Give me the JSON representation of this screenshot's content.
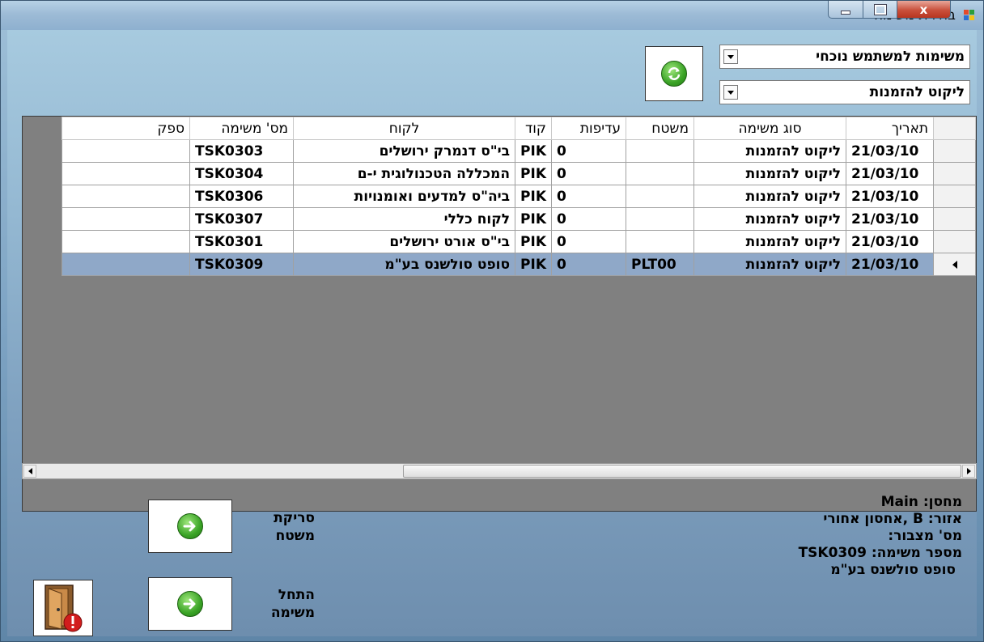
{
  "window": {
    "title": "בחירת משימה",
    "controls": {
      "minimize": "–",
      "maximize": "□",
      "close": "x"
    }
  },
  "filters": {
    "list_selector": "משימות למשתמש נוכחי",
    "task_type_selector": "ליקוט להזמנות"
  },
  "grid": {
    "columns": [
      "תאריך",
      "סוג משימה",
      "משטח",
      "עדיפות",
      "קוד",
      "לקוח",
      "מס' משימה",
      "ספק"
    ],
    "rows": [
      {
        "date": "21/03/10",
        "type": "ליקוט להזמנות",
        "pallet": "",
        "priority": "0",
        "code": "PIK",
        "customer": "בי\"ס דנמרק ירושלים",
        "task_no": "TSK0303",
        "supplier": ""
      },
      {
        "date": "21/03/10",
        "type": "ליקוט להזמנות",
        "pallet": "",
        "priority": "0",
        "code": "PIK",
        "customer": "המכללה הטכנולוגית י-ם",
        "task_no": "TSK0304",
        "supplier": ""
      },
      {
        "date": "21/03/10",
        "type": "ליקוט להזמנות",
        "pallet": "",
        "priority": "0",
        "code": "PIK",
        "customer": "ביה\"ס למדעים ואומנויות",
        "task_no": "TSK0306",
        "supplier": ""
      },
      {
        "date": "21/03/10",
        "type": "ליקוט להזמנות",
        "pallet": "",
        "priority": "0",
        "code": "PIK",
        "customer": "לקוח כללי",
        "task_no": "TSK0307",
        "supplier": ""
      },
      {
        "date": "21/03/10",
        "type": "ליקוט להזמנות",
        "pallet": "",
        "priority": "0",
        "code": "PIK",
        "customer": "בי\"ס אורט ירושלים",
        "task_no": "TSK0301",
        "supplier": ""
      },
      {
        "date": "21/03/10",
        "type": "ליקוט להזמנות",
        "pallet": "PLT00",
        "priority": "0",
        "code": "PIK",
        "customer": "סופט סולשנס בע\"מ",
        "task_no": "TSK0309",
        "supplier": "",
        "selected": true
      }
    ]
  },
  "info": {
    "warehouse": "מחסן: Main",
    "zone": "אזור: B ,אחסון אחורי",
    "stack_no": "מס' מצבור:",
    "task_no": "מספר משימה: TSK0309",
    "customer": "סופט סולשנס בע\"מ"
  },
  "buttons": {
    "scan_pallet_line1": "סריקת",
    "scan_pallet_line2": "משטח",
    "start_task_line1": "התחל",
    "start_task_line2": "משימה"
  },
  "icons": {
    "refresh": "refresh-icon",
    "go": "arrow-right-circle-icon",
    "exit": "door-exit-icon"
  },
  "colors": {
    "selected_row": "#8fa8c8",
    "go_green": "#3aa326"
  }
}
